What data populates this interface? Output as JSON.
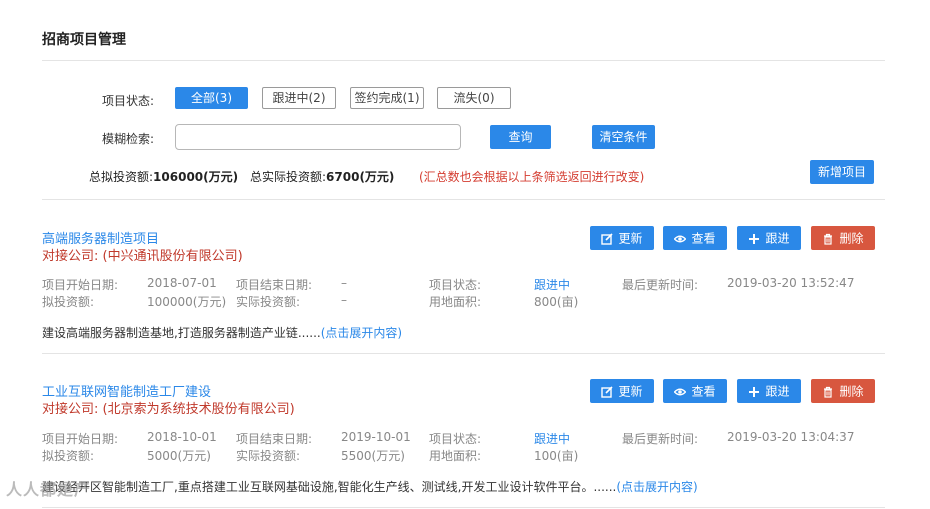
{
  "page_title": "招商项目管理",
  "filters": {
    "status_label": "项目状态:",
    "status_options": [
      "全部(3)",
      "跟进中(2)",
      "签约完成(1)",
      "流失(0)"
    ],
    "selected_index": 0,
    "search_label": "模糊检索:",
    "search_value": "",
    "search_placeholder": "",
    "search_button": "查询",
    "clear_button": "清空条件"
  },
  "summary": {
    "planned_label": "总拟投资额:",
    "planned_value": "106000(万元)",
    "actual_label": "总实际投资额:",
    "actual_value": "6700(万元)",
    "note": "(汇总数也会根据以上条筛选返回进行改变)",
    "add_button": "新增项目"
  },
  "actions": {
    "update": "更新",
    "view": "查看",
    "follow": "跟进",
    "delete": "删除"
  },
  "field_labels": {
    "start_date": "项目开始日期:",
    "end_date": "项目结束日期:",
    "status": "项目状态:",
    "last_update": "最后更新时间:",
    "planned_investment": "拟投资额:",
    "actual_investment": "实际投资额:",
    "land_area": "用地面积:"
  },
  "projects": [
    {
      "name": "高端服务器制造项目",
      "company": "对接公司: (中兴通讯股份有限公司)",
      "start_date": "2018-07-01",
      "end_date": "–",
      "status": "跟进中",
      "last_update": "2019-03-20 13:52:47",
      "planned_investment": "100000(万元)",
      "actual_investment": "–",
      "land_area": "800(亩)",
      "description": "建设高端服务器制造基地,打造服务器制造产业链......",
      "expand": "(点击展开内容)"
    },
    {
      "name": "工业互联网智能制造工厂建设",
      "company": "对接公司: (北京索为系统技术股份有限公司)",
      "start_date": "2018-10-01",
      "end_date": "2019-10-01",
      "status": "跟进中",
      "last_update": "2019-03-20 13:04:37",
      "planned_investment": "5000(万元)",
      "actual_investment": "5500(万元)",
      "land_area": "100(亩)",
      "description": "建设经开区智能制造工厂,重点搭建工业互联网基础设施,智能化生产线、测试线,开发工业设计软件平台。......",
      "expand": "(点击展开内容)"
    }
  ],
  "watermark": "人人都是产"
}
